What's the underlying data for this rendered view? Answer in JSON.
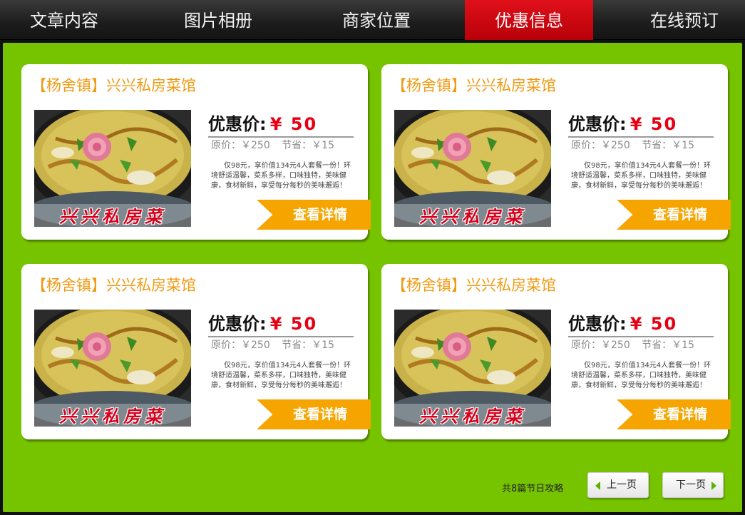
{
  "nav": {
    "items": [
      "文章内容",
      "图片相册",
      "商家位置",
      "优惠信息",
      "在线预订"
    ],
    "active_index": 3,
    "active_color": "#e0101a"
  },
  "deal": {
    "title": "【杨舍镇】兴兴私房菜馆",
    "price_label": "优惠价:",
    "price_value": "¥ 50",
    "orig_price": "原价：￥250",
    "saving": "节省：￥15",
    "description": "仅98元，享价值134元4人套餐一份！环境舒适温馨，菜系多样，口味独特，美味健康，食材新鲜，享受每分每秒的美味邂逅！",
    "image_caption": "兴兴私房菜",
    "detail_button": "查看详情"
  },
  "cards_count": 4,
  "pager": {
    "info": "共8篇节日攻略",
    "prev": "上一页",
    "next": "下一页"
  },
  "colors": {
    "background": "#76c300",
    "title": "#f19a12",
    "price": "#e60012",
    "button": "#f6a500"
  }
}
